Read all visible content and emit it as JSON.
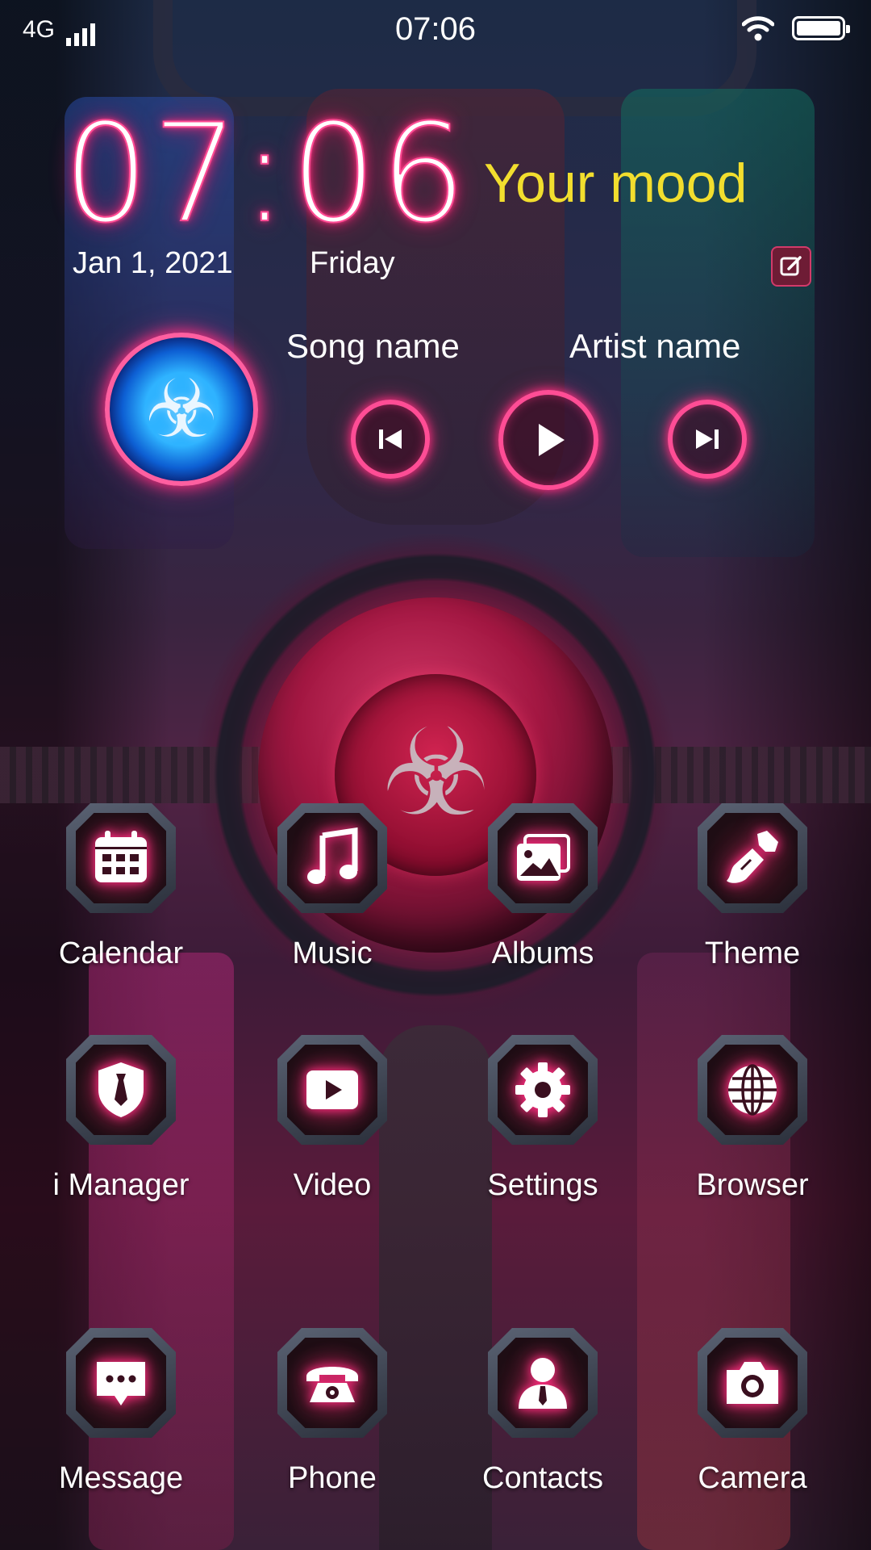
{
  "status_bar": {
    "network": "4G",
    "time": "07:06"
  },
  "clock_widget": {
    "time": "07:06",
    "date": "Jan 1, 2021",
    "weekday": "Friday",
    "mood": "Your mood"
  },
  "music_widget": {
    "song": "Song name",
    "artist": "Artist name"
  },
  "apps": [
    {
      "label": "Calendar",
      "icon": "calendar-icon"
    },
    {
      "label": "Music",
      "icon": "music-note-icon"
    },
    {
      "label": "Albums",
      "icon": "photos-icon"
    },
    {
      "label": "Theme",
      "icon": "paint-brush-icon"
    },
    {
      "label": "i Manager",
      "icon": "shield-tie-icon"
    },
    {
      "label": "Video",
      "icon": "play-video-icon"
    },
    {
      "label": "Settings",
      "icon": "gear-icon"
    },
    {
      "label": "Browser",
      "icon": "globe-icon"
    },
    {
      "label": "Message",
      "icon": "chat-bubble-icon"
    },
    {
      "label": "Phone",
      "icon": "telephone-icon"
    },
    {
      "label": "Contacts",
      "icon": "person-icon"
    },
    {
      "label": "Camera",
      "icon": "camera-icon"
    }
  ],
  "colors": {
    "neon_pink": "#ff4d95",
    "mood_yellow": "#f2de2e",
    "disc_blue": "#1e7fe8"
  }
}
